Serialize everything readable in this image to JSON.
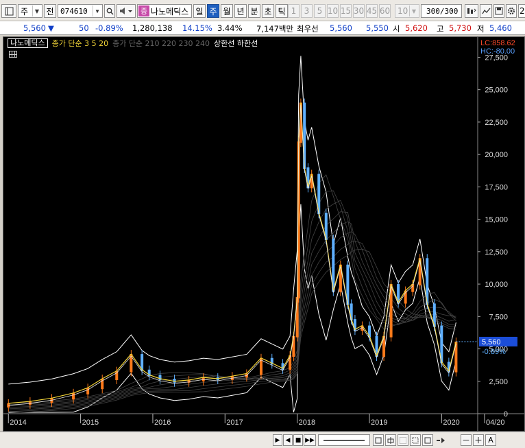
{
  "toolbar": {
    "market_label": "주",
    "prev_label": "전",
    "stock_code": "074610",
    "stock_tag": "증",
    "stock_name": "나노메딕스",
    "periods": [
      "일",
      "주",
      "월",
      "년",
      "분",
      "초",
      "틱"
    ],
    "active_period": "주",
    "intervals": [
      "1",
      "3",
      "5",
      "10",
      "15",
      "30",
      "45",
      "60"
    ],
    "count_select": "10",
    "page_count": "300",
    "page_total": "/300",
    "trailing_label": "2"
  },
  "price_row": {
    "price": "5,560",
    "change": "50",
    "change_pct": "-0.89%",
    "volume": "1,280,138",
    "turnover_pct": "14.15%",
    "other_pct": "3.44%",
    "amount": "7,147백만",
    "best_label": "최우선",
    "ask": "5,560",
    "bid": "5,550",
    "open_label": "시",
    "open": "5,620",
    "high_label": "고",
    "high": "5,730",
    "low_label": "저",
    "low": "5,460"
  },
  "legend": {
    "name": "나노메딕스",
    "ma_fast": "종가 단순 3 5 20",
    "ma_slow": "종가 단순 210 220 230 240",
    "limits": "상한선 하한선"
  },
  "chart_data": {
    "type": "line",
    "title": "나노메딕스",
    "lc_label": "LC:858.62",
    "hc_label": "HC:-80.00",
    "y_ticks": [
      "27,500",
      "25,000",
      "22,500",
      "20,000",
      "17,500",
      "15,000",
      "12,500",
      "10,000",
      "7,500",
      "5,000",
      "2,500",
      "0"
    ],
    "x_ticks": [
      "2014",
      "2015",
      "2016",
      "2017",
      "2018",
      "2019",
      "2020",
      "04/20"
    ],
    "ylim": [
      0,
      28000
    ],
    "current_price": "5,560",
    "current_change": "-0.89%",
    "series": [
      {
        "name": "종가",
        "x": [
          2014.0,
          2014.3,
          2014.6,
          2014.9,
          2015.1,
          2015.3,
          2015.5,
          2015.7,
          2015.85,
          2015.95,
          2016.1,
          2016.3,
          2016.5,
          2016.7,
          2016.9,
          2017.1,
          2017.3,
          2017.5,
          2017.65,
          2017.8,
          2017.9,
          2017.95,
          2018.0,
          2018.02,
          2018.05,
          2018.1,
          2018.15,
          2018.2,
          2018.3,
          2018.4,
          2018.5,
          2018.6,
          2018.7,
          2018.75,
          2018.8,
          2018.9,
          2019.0,
          2019.1,
          2019.2,
          2019.3,
          2019.4,
          2019.5,
          2019.6,
          2019.7,
          2019.8,
          2019.9,
          2020.0,
          2020.1,
          2020.2
        ],
        "values": [
          800,
          950,
          1200,
          1600,
          2000,
          2700,
          3300,
          4600,
          3400,
          3000,
          2700,
          2500,
          2600,
          2800,
          2700,
          2900,
          3100,
          4300,
          3900,
          3500,
          4500,
          6000,
          9000,
          21000,
          24000,
          19000,
          17500,
          18500,
          15500,
          13500,
          9500,
          11500,
          8500,
          7300,
          6500,
          6800,
          6000,
          4500,
          6000,
          10000,
          8600,
          9500,
          10000,
          12000,
          8500,
          6800,
          4000,
          3300,
          5560
        ]
      }
    ]
  },
  "bottom": {
    "labels": [
      "▶",
      "◀",
      "■",
      "▶▶",
      "－",
      "＋",
      "A"
    ]
  }
}
